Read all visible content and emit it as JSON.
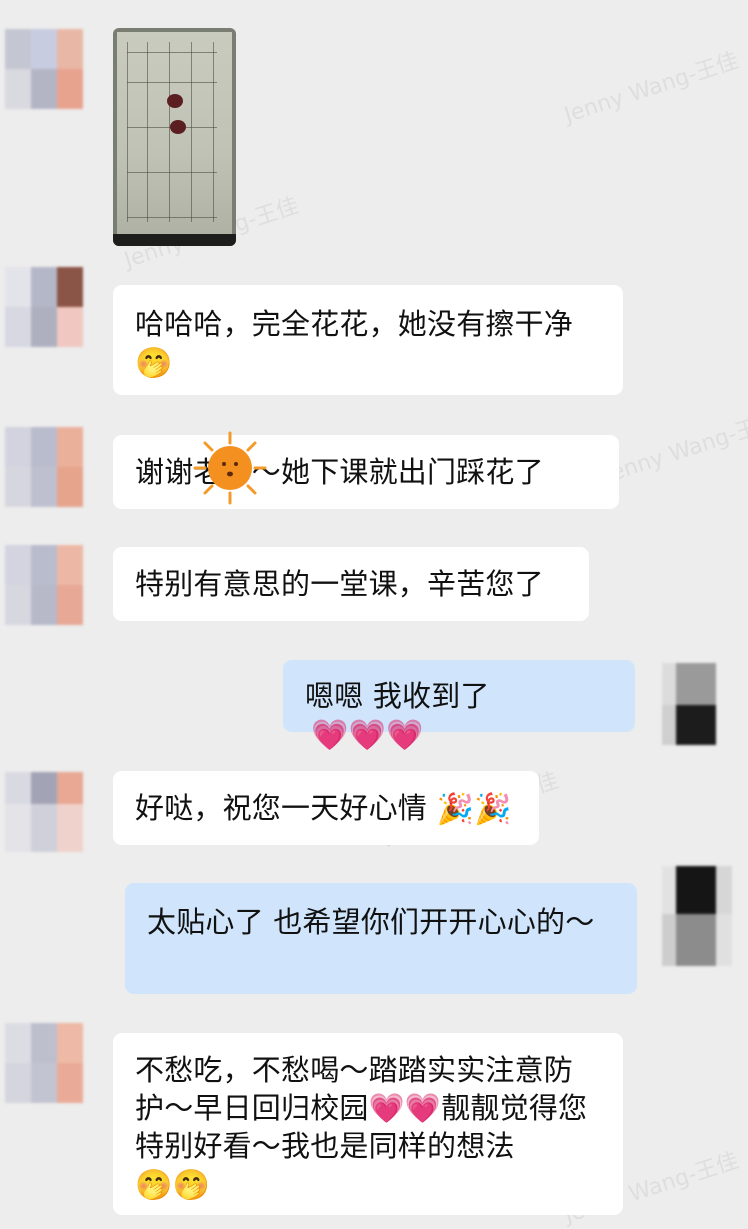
{
  "watermark": "Jenny Wang-王佳",
  "messages": [
    {
      "side": "recv",
      "type": "image"
    },
    {
      "side": "recv",
      "text": "哈哈哈，完全花花，她没有擦干净",
      "emoji": "🤭"
    },
    {
      "side": "recv",
      "text": "谢谢老师～她下课就出门踩花了"
    },
    {
      "side": "recv",
      "text": "特别有意思的一堂课，辛苦您了"
    },
    {
      "side": "sent",
      "text": "嗯嗯 我收到了",
      "emoji": "💗💗💗"
    },
    {
      "side": "recv",
      "text": "好哒，祝您一天好心情",
      "emoji": "🎉🎉"
    },
    {
      "side": "sent",
      "text": "太贴心了 也希望你们开开心心的～"
    },
    {
      "side": "recv",
      "text": "不愁吃，不愁喝～踏踏实实注意防护～早日回归校园💗💗靓靓觉得您特别好看～我也是同样的想法",
      "emoji": "🤭🤭"
    }
  ],
  "colors": {
    "background": "#ededed",
    "received_bubble": "#ffffff",
    "sent_bubble": "#d0e5fb"
  }
}
